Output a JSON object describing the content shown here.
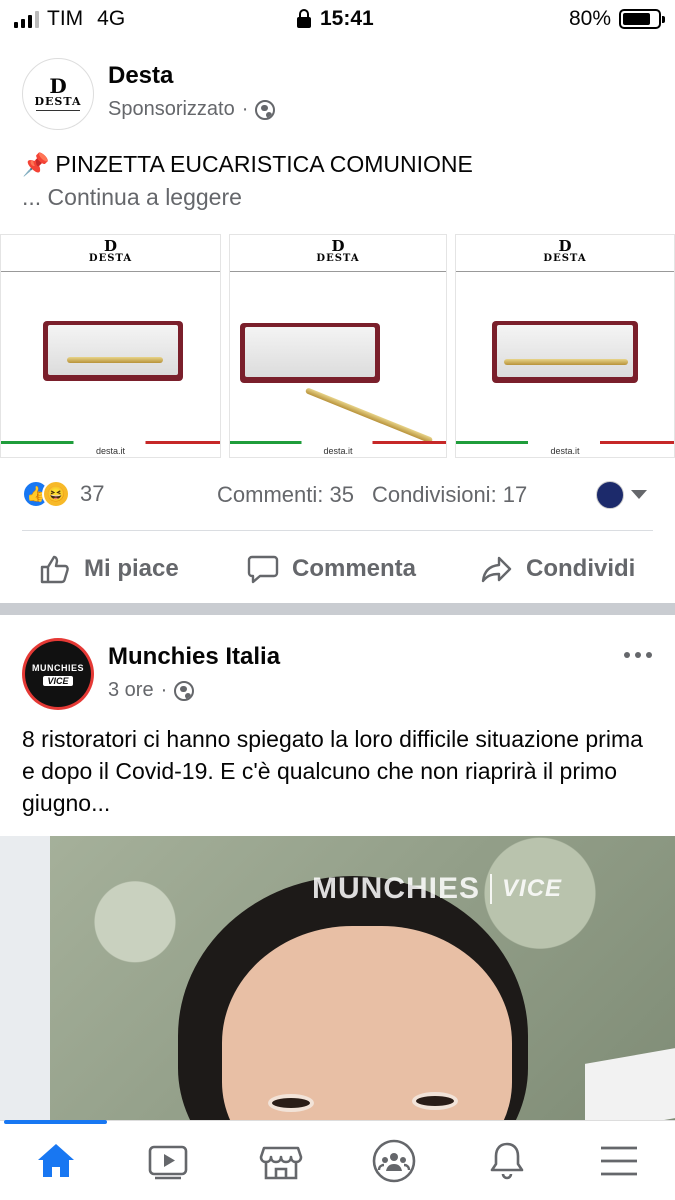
{
  "status_bar": {
    "carrier": "TIM",
    "network": "4G",
    "time": "15:41",
    "battery": "80%",
    "battery_level": 0.8
  },
  "post1": {
    "author": "Desta",
    "avatar_logo": {
      "mark": "D",
      "word": "DESTA"
    },
    "meta": "Sponsorizzato",
    "meta_separator": "·",
    "text": "PINZETTA EUCARISTICA COMUNIONE",
    "more": "... Continua a leggere",
    "gallery": [
      {
        "logo": "DESTA",
        "site": "desta.it"
      },
      {
        "logo": "DESTA",
        "site": "desta.it"
      },
      {
        "logo": "DESTA",
        "site": "desta.it"
      }
    ],
    "reaction_count": "37",
    "comments": "Commenti: 35",
    "shares": "Condivisioni: 17",
    "actions": {
      "like": "Mi piace",
      "comment": "Commenta",
      "share": "Condividi"
    }
  },
  "post2": {
    "author": "Munchies Italia",
    "avatar_logo": {
      "line1": "MUNCHIES",
      "line2": "VICE"
    },
    "meta": "3 ore",
    "meta_separator": "·",
    "text": "8 ristoratori ci hanno spiegato la loro difficile situazione prima e dopo il Covid-19. E c'è qualcuno che non riaprirà il primo giugno...",
    "video_watermark": {
      "brand": "MUNCHIES",
      "partner": "VICE"
    }
  },
  "tabbar": {
    "active": "home",
    "tabs": [
      "home-icon",
      "watch-icon",
      "marketplace-icon",
      "groups-icon",
      "notifications-icon",
      "menu-icon"
    ]
  },
  "colors": {
    "accent": "#1877f2",
    "secondary_text": "#65676b"
  }
}
